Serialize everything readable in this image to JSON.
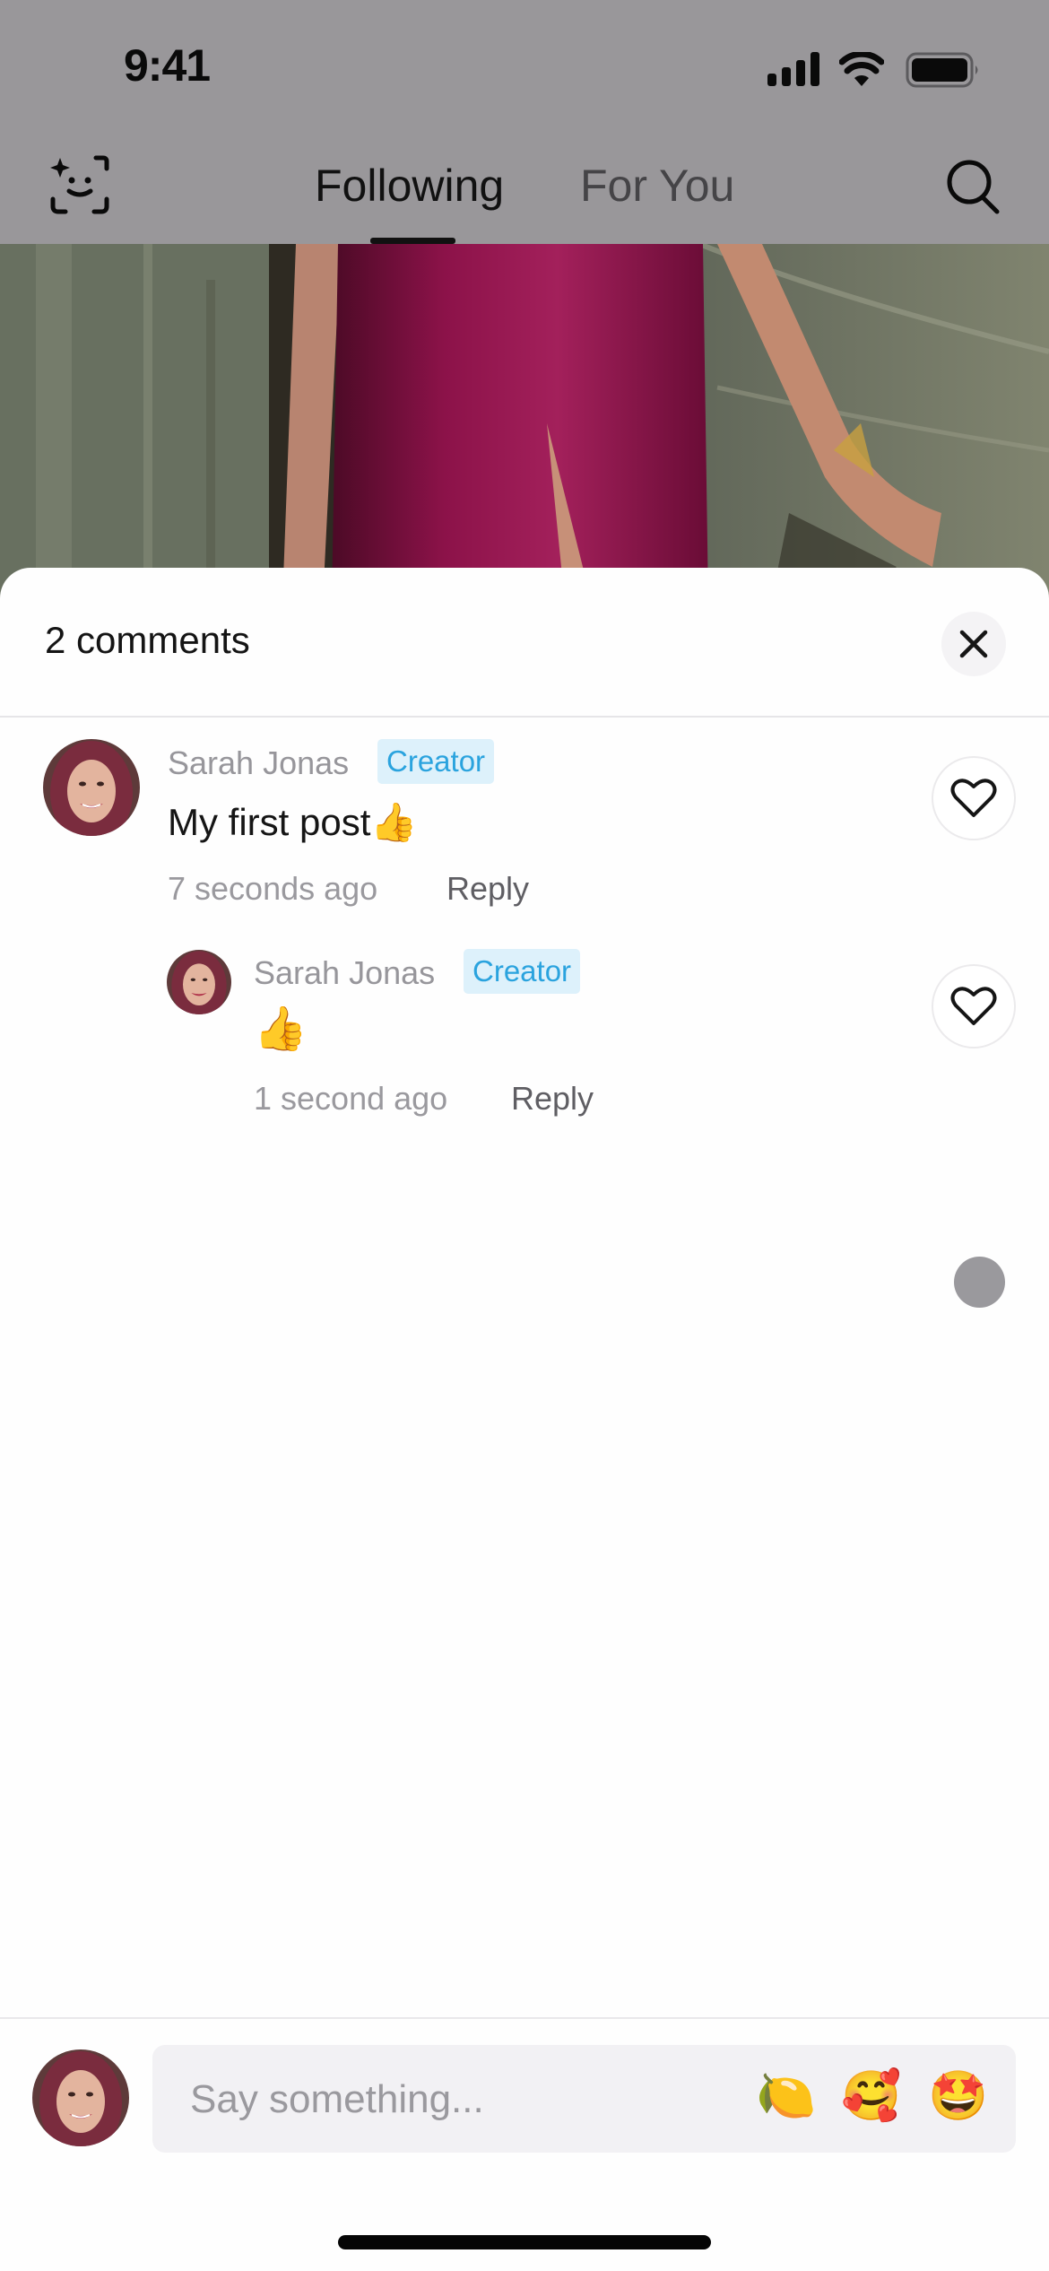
{
  "status_bar": {
    "time": "9:41",
    "signal_icon": "cellular-signal-icon",
    "wifi_icon": "wifi-icon",
    "battery_icon": "battery-full-icon"
  },
  "top_nav": {
    "left_icon": "face-scan-sparkle-icon",
    "tabs": [
      {
        "label": "Following",
        "active": true
      },
      {
        "label": "For You",
        "active": false
      }
    ],
    "right_icon": "search-icon"
  },
  "comments_sheet": {
    "title": "2 comments",
    "close_icon": "close-icon",
    "comments": [
      {
        "author": "Sarah Jonas",
        "badge": "Creator",
        "text": "My first post👍",
        "time": "7 seconds ago",
        "reply_label": "Reply",
        "like_icon": "heart-outline-icon",
        "replies": [
          {
            "author": "Sarah Jonas",
            "badge": "Creator",
            "text": "👍",
            "time": "1 second ago",
            "reply_label": "Reply",
            "like_icon": "heart-outline-icon"
          }
        ]
      }
    ]
  },
  "composer": {
    "placeholder": "Say something...",
    "value": "",
    "quick_emojis": [
      "🍋",
      "🥰",
      "🤩"
    ]
  },
  "colors": {
    "badge_text": "#2aa3de",
    "badge_bg": "#ddf1fb",
    "overlay_gray": "#99979a",
    "dress": "#8c1249"
  }
}
